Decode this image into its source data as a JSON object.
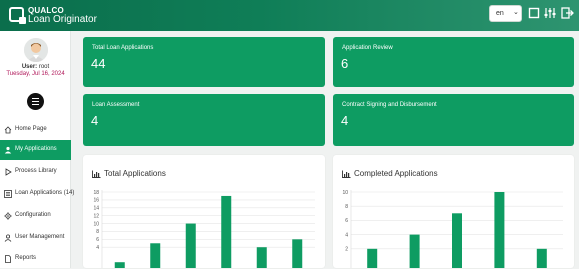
{
  "header": {
    "brand_top": "QUALCO",
    "brand_bottom": "Loan Originator",
    "language": "en"
  },
  "user": {
    "label": "User:",
    "name": "root",
    "date": "Tuesday, Jul 16, 2024"
  },
  "nav": {
    "items": [
      {
        "label": "Home Page",
        "icon": "home-icon"
      },
      {
        "label": "My Applications",
        "icon": "user-applications-icon",
        "active": true
      },
      {
        "label": "Process Library",
        "icon": "play-icon"
      },
      {
        "label": "Loan Applications",
        "count": "(14)",
        "icon": "list-icon"
      },
      {
        "label": "Configuration",
        "icon": "gear-icon"
      },
      {
        "label": "User Management",
        "icon": "user-icon"
      },
      {
        "label": "Reports",
        "icon": "document-icon"
      }
    ]
  },
  "cards": [
    {
      "title": "Total Loan Applications",
      "value": "44"
    },
    {
      "title": "Application Review",
      "value": "6"
    },
    {
      "title": "Loan Assessment",
      "value": "4"
    },
    {
      "title": "Contract Signing and Disbursement",
      "value": "4"
    }
  ],
  "colors": {
    "accent": "#0e9c62",
    "date": "#b0185a"
  },
  "chart_data": [
    {
      "type": "bar",
      "title": "Total Applications",
      "yticks": [
        "18",
        "16",
        "14",
        "12",
        "10",
        "8",
        "6",
        "4"
      ],
      "ylim": [
        0,
        18
      ],
      "values": [
        0.2,
        5,
        10,
        17,
        4,
        6
      ]
    },
    {
      "type": "bar",
      "title": "Completed Applications",
      "yticks": [
        "10",
        "8",
        "6",
        "4",
        "2"
      ],
      "ylim": [
        0,
        10
      ],
      "values": [
        2,
        4,
        7,
        10,
        2
      ]
    }
  ]
}
